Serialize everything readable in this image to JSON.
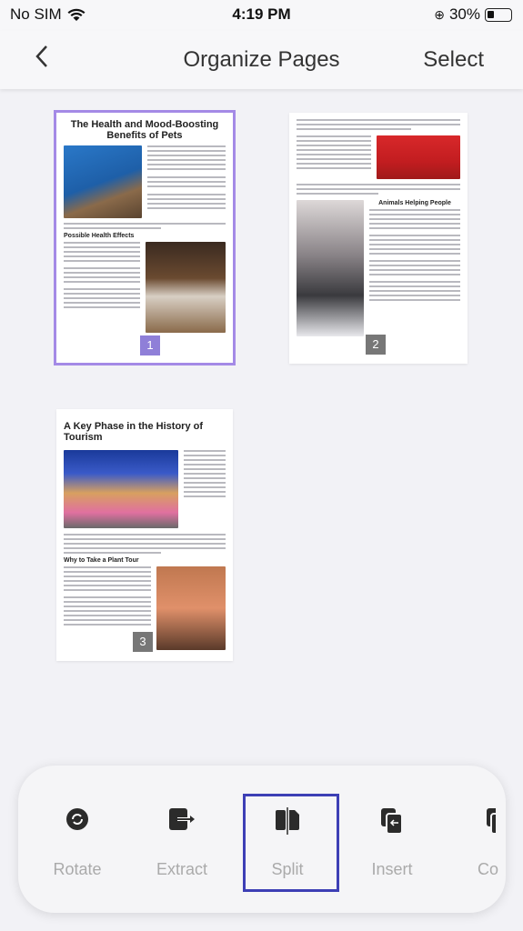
{
  "status": {
    "carrier": "No SIM",
    "time": "4:19 PM",
    "battery": "30%"
  },
  "nav": {
    "back": "<",
    "title": "Organize Pages",
    "select": "Select"
  },
  "pages": [
    {
      "number": "1",
      "title": "The Health and Mood-Boosting Benefits of Pets",
      "heading": "Possible Health Effects",
      "selected": true
    },
    {
      "number": "2",
      "heading": "Animals Helping People",
      "selected": false
    },
    {
      "number": "3",
      "title": "A Key Phase in the History of Tourism",
      "heading": "Why to Take a Plant Tour",
      "selected": false
    }
  ],
  "toolbar": {
    "items": [
      {
        "label": "Rotate",
        "icon": "rotate-icon"
      },
      {
        "label": "Extract",
        "icon": "extract-icon"
      },
      {
        "label": "Split",
        "icon": "split-icon",
        "highlighted": true
      },
      {
        "label": "Insert",
        "icon": "insert-icon"
      },
      {
        "label": "Co",
        "icon": "copy-icon"
      }
    ]
  },
  "colors": {
    "selected_border": "#a48ae6",
    "highlight": "#3d3fb5"
  }
}
